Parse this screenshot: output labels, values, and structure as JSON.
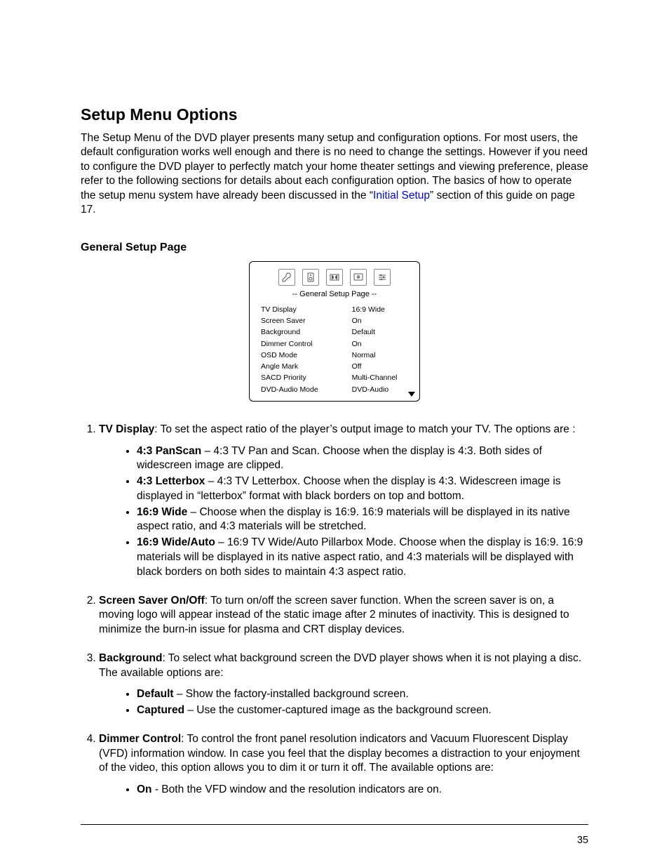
{
  "heading": "Setup Menu Options",
  "intro": {
    "t1": "The Setup Menu of the DVD player presents many setup and configuration options.  For most users, the default configuration works well enough and there is no need to change the settings.  However if you need to configure the DVD player to perfectly match your home theater settings and viewing preference, please refer to the following sections for details about each configuration option.  The basics of how to operate the setup menu system have already been discussed in the “",
    "link": "Initial Setup",
    "t2": "” section of this guide on page 17."
  },
  "section": "General Setup Page",
  "menu": {
    "title": "-- General Setup Page --",
    "rows": [
      {
        "l": "TV Display",
        "r": "16:9 Wide"
      },
      {
        "l": "Screen Saver",
        "r": "On"
      },
      {
        "l": "Background",
        "r": "Default"
      },
      {
        "l": "Dimmer Control",
        "r": "On"
      },
      {
        "l": "OSD Mode",
        "r": "Normal"
      },
      {
        "l": "Angle Mark",
        "r": "Off"
      },
      {
        "l": "SACD Priority",
        "r": "Multi-Channel"
      },
      {
        "l": "DVD-Audio Mode",
        "r": "DVD-Audio"
      }
    ]
  },
  "items": {
    "i1": {
      "lead": "TV Display",
      "text": ": To set the aspect ratio of the player’s output image to match your TV.  The options are :",
      "sub": [
        {
          "lead": "4:3 PanScan",
          "text": " – 4:3 TV Pan and Scan.  Choose when the display is 4:3. Both sides of widescreen image are clipped."
        },
        {
          "lead": "4:3 Letterbox",
          "text": " – 4:3 TV Letterbox.  Choose when the display is 4:3.  Widescreen image is displayed in “letterbox” format with black borders on top and bottom."
        },
        {
          "lead": "16:9 Wide",
          "text": " – Choose when the display is 16:9.  16:9 materials will be displayed in its native aspect ratio, and 4:3 materials will be stretched."
        },
        {
          "lead": "16:9 Wide/Auto",
          "text": " – 16:9 TV Wide/Auto Pillarbox Mode.  Choose when the display is 16:9.  16:9 materials will be displayed in its native aspect ratio, and 4:3 materials will be displayed with black borders on both sides to maintain 4:3 aspect ratio."
        }
      ]
    },
    "i2": {
      "lead": "Screen Saver On/Off",
      "text": ": To turn on/off the screen saver function.  When the screen saver is on, a moving logo will appear instead of the static image after 2 minutes of inactivity.  This is designed to minimize the burn-in issue for plasma and CRT display devices."
    },
    "i3": {
      "lead": "Background",
      "text": ": To select what background screen the DVD player shows when it is not playing a disc.  The available options are:",
      "sub": [
        {
          "lead": "Default",
          "text": " – Show the factory-installed background screen."
        },
        {
          "lead": "Captured",
          "text": " – Use the customer-captured image as the background screen."
        }
      ]
    },
    "i4": {
      "lead": "Dimmer Control",
      "text": ": To control the front panel resolution indicators and Vacuum Fluorescent Display (VFD) information window.  In case you feel that the display becomes a distraction to your enjoyment of the video, this option allows you to dim it or turn it off.  The available options are:",
      "sub": [
        {
          "lead": "On",
          "text": " - Both the VFD window and the resolution indicators are on."
        }
      ]
    }
  },
  "page_number": "35"
}
